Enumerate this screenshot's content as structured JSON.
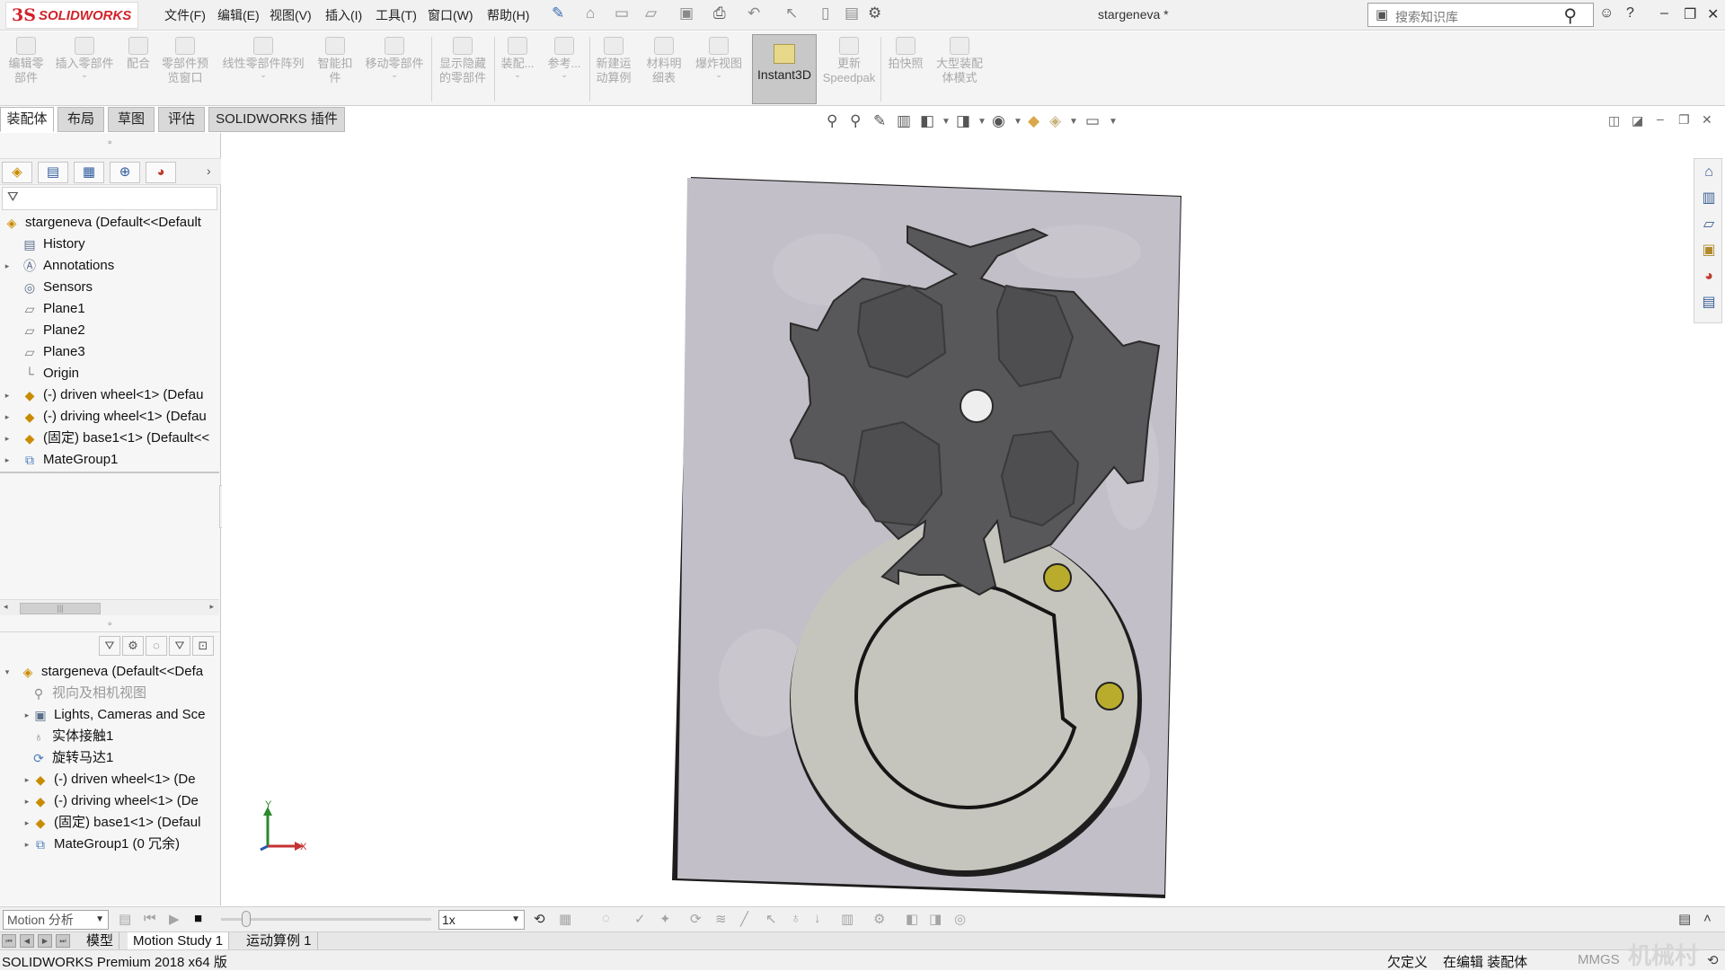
{
  "app": {
    "brand_ds": "3S",
    "brand_name": "SOLIDWORKS",
    "doc_title": "stargeneva *"
  },
  "menu": [
    "文件(F)",
    "编辑(E)",
    "视图(V)",
    "插入(I)",
    "工具(T)",
    "窗口(W)",
    "帮助(H)"
  ],
  "search": {
    "placeholder": "搜索知识库"
  },
  "commands": [
    {
      "l1": "编辑零",
      "l2": "部件"
    },
    {
      "l1": "插入零部件",
      "l2": ""
    },
    {
      "l1": "配合",
      "l2": ""
    },
    {
      "l1": "零部件预",
      "l2": "览窗口"
    },
    {
      "l1": "线性零部件阵列",
      "l2": ""
    },
    {
      "l1": "智能扣",
      "l2": "件"
    },
    {
      "l1": "移动零部件",
      "l2": ""
    },
    {
      "l1": "显示隐藏",
      "l2": "的零部件"
    },
    {
      "l1": "装配...",
      "l2": ""
    },
    {
      "l1": "参考...",
      "l2": ""
    },
    {
      "l1": "新建运",
      "l2": "动算例"
    },
    {
      "l1": "材料明",
      "l2": "细表"
    },
    {
      "l1": "爆炸视图",
      "l2": ""
    },
    {
      "l1": "更新",
      "l2": "Speedpak"
    },
    {
      "l1": "拍快照",
      "l2": ""
    },
    {
      "l1": "大型装配",
      "l2": "体模式"
    }
  ],
  "instant3d_label": "Instant3D",
  "tabs": [
    "装配体",
    "布局",
    "草图",
    "评估",
    "SOLIDWORKS 插件"
  ],
  "feature_tree": [
    {
      "label": "stargeneva  (Default<<Default",
      "icon": "assembly-icon"
    },
    {
      "label": "History",
      "icon": "history-icon"
    },
    {
      "label": "Annotations",
      "icon": "annotations-icon"
    },
    {
      "label": "Sensors",
      "icon": "sensors-icon"
    },
    {
      "label": "Plane1",
      "icon": "plane-icon"
    },
    {
      "label": "Plane2",
      "icon": "plane-icon"
    },
    {
      "label": "Plane3",
      "icon": "plane-icon"
    },
    {
      "label": "Origin",
      "icon": "origin-icon"
    },
    {
      "label": "(-) driven wheel<1> (Defau",
      "icon": "part-icon"
    },
    {
      "label": "(-) driving wheel<1> (Defau",
      "icon": "part-icon"
    },
    {
      "label": "(固定) base1<1> (Default<<",
      "icon": "part-icon"
    },
    {
      "label": "MateGroup1",
      "icon": "mate-icon"
    }
  ],
  "motion_tree": [
    {
      "label": "stargeneva  (Default<<Defa",
      "icon": "assembly-icon"
    },
    {
      "label": "视向及相机视图",
      "icon": "camera-icon"
    },
    {
      "label": "Lights, Cameras and Sce",
      "icon": "lights-icon"
    },
    {
      "label": "实体接触1",
      "icon": "contact-icon"
    },
    {
      "label": "旋转马达1",
      "icon": "motor-icon"
    },
    {
      "label": "(-) driven wheel<1> (De",
      "icon": "part-icon"
    },
    {
      "label": "(-) driving wheel<1> (De",
      "icon": "part-icon"
    },
    {
      "label": "(固定) base1<1> (Defaul",
      "icon": "part-icon"
    },
    {
      "label": "MateGroup1 (0 冗余)",
      "icon": "mate-icon"
    }
  ],
  "triad": {
    "x": "X",
    "y": "Y"
  },
  "motion_bar": {
    "study_type": "Motion 分析",
    "playback_speed": "1x"
  },
  "bottom_tabs": [
    "模型",
    "Motion Study 1",
    "运动算例 1"
  ],
  "status": {
    "product": "SOLIDWORKS Premium 2018 x64 版",
    "underdefined": "欠定义",
    "editing": "在编辑 装配体",
    "units": "MMGS"
  },
  "watermark": "机械村",
  "colors": {
    "brand_red": "#d2232a",
    "plate": "#c3bfc8",
    "star_wheel": "#5a5a5c",
    "drive_wheel": "#c6c5bd",
    "pins": "#b9ac2c"
  }
}
